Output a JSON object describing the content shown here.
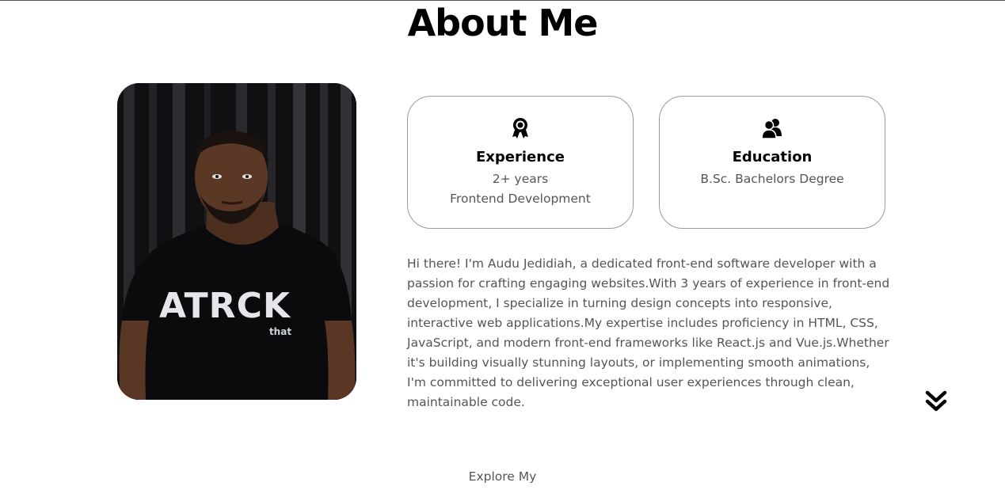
{
  "section": {
    "title": "About Me"
  },
  "profile_photo": {
    "shirt_text": "ATRCK",
    "shirt_subtext": "that"
  },
  "cards": {
    "experience": {
      "icon": "award-icon",
      "title": "Experience",
      "line1": "2+ years",
      "line2": "Frontend Development"
    },
    "education": {
      "icon": "users-icon",
      "title": "Education",
      "line1": "B.Sc. Bachelors Degree"
    }
  },
  "bio": {
    "text": "Hi there! I'm Audu Jedidiah, a dedicated front-end software developer with a passion for crafting engaging websites.With 3 years of experience in front-end development, I specialize in turning design concepts into responsive, interactive web applications.My expertise includes proficiency in HTML, CSS, JavaScript, and modern front-end frameworks like React.js and Vue.js.Whether it's building visually stunning layouts, or implementing smooth animations, I'm committed to delivering exceptional user experiences through clean, maintainable code."
  },
  "navigation": {
    "scroll_icon": "double-chevron-down-icon"
  },
  "next_section": {
    "label": "Explore My"
  }
}
